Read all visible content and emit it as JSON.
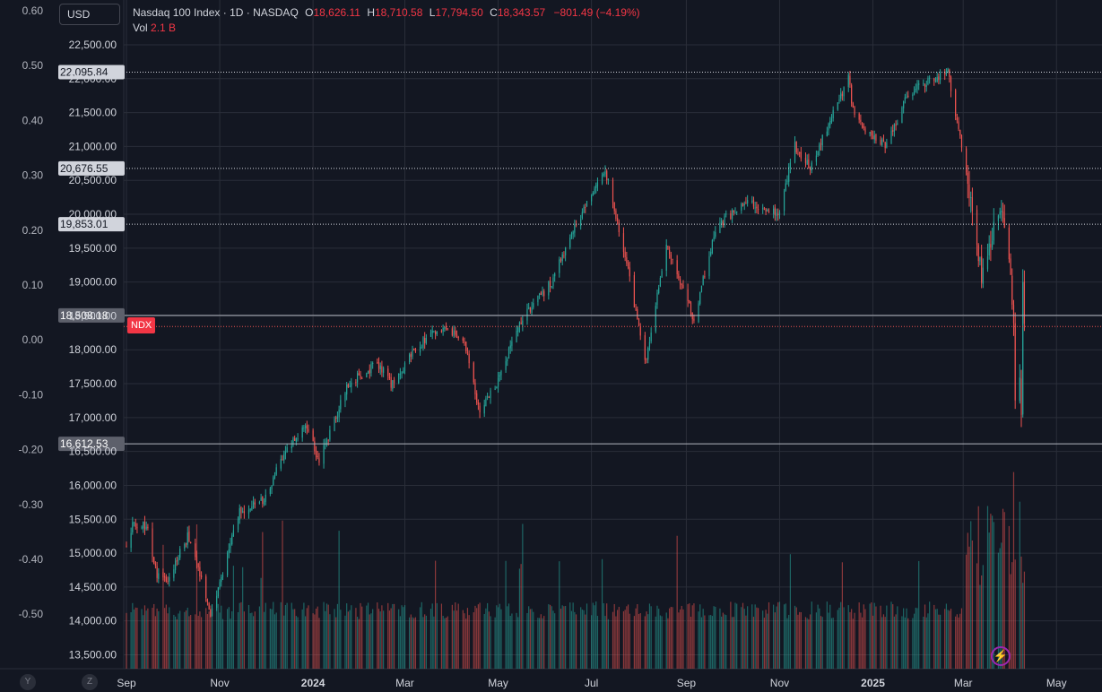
{
  "toolbar": {
    "currency": "USD"
  },
  "legend": {
    "symbol": "Nasdaq 100 Index",
    "interval": "1D",
    "exchange": "NASDAQ",
    "open_label": "O",
    "open": "18,626.11",
    "high_label": "H",
    "high": "18,710.58",
    "low_label": "L",
    "low": "17,794.50",
    "close_label": "C",
    "close": "18,343.57",
    "change": "−801.49 (−4.19%)",
    "vol_label": "Vol",
    "vol": "2.1 B"
  },
  "series_tag": "NDX",
  "corner_buttons": [
    "Y",
    "Z"
  ],
  "colors": {
    "background": "#131722",
    "grid": "#2a2e39",
    "up": "#26a69a",
    "down": "#ef5350",
    "accent": "#f23645"
  },
  "icons": {
    "alert": "lightning-icon"
  },
  "chart_data": {
    "type": "candlestick",
    "symbol": "NDX",
    "left_axis_ticks": [
      "0.60",
      "0.50",
      "0.40",
      "0.30",
      "0.20",
      "0.10",
      "0.00",
      "-0.10",
      "-0.20",
      "-0.30",
      "-0.40",
      "-0.50"
    ],
    "price_ticks": [
      "22,500.00",
      "22,000.00",
      "21,500.00",
      "21,000.00",
      "20,500.00",
      "20,000.00",
      "19,500.00",
      "19,000.00",
      "18,500.00",
      "18,000.00",
      "17,500.00",
      "17,000.00",
      "16,500.00",
      "16,000.00",
      "15,500.00",
      "15,000.00",
      "14,500.00",
      "14,000.00",
      "13,500.00"
    ],
    "price_markers": [
      {
        "value": 22095.84,
        "label": "22,095.84"
      },
      {
        "value": 20676.55,
        "label": "20,676.55"
      },
      {
        "value": 19853.01,
        "label": "19,853.01"
      },
      {
        "value": 18508.18,
        "label": "18,508.18"
      },
      {
        "value": 16612.53,
        "label": "16,612.53"
      }
    ],
    "time_labels": [
      {
        "label": "Sep",
        "date": "2023-09-01"
      },
      {
        "label": "Nov",
        "date": "2023-11-01"
      },
      {
        "label": "2024",
        "date": "2024-01-01",
        "bold": true
      },
      {
        "label": "Mar",
        "date": "2024-03-01"
      },
      {
        "label": "May",
        "date": "2024-05-01"
      },
      {
        "label": "Jul",
        "date": "2024-07-01"
      },
      {
        "label": "Sep",
        "date": "2024-09-01"
      },
      {
        "label": "Nov",
        "date": "2024-11-01"
      },
      {
        "label": "2025",
        "date": "2025-01-01",
        "bold": true
      },
      {
        "label": "Mar",
        "date": "2025-03-01"
      },
      {
        "label": "May",
        "date": "2025-05-01"
      }
    ],
    "start_date": "2023-09-01",
    "end_date": "2025-04-10",
    "keypoints": [
      [
        "2023-09-01",
        15100
      ],
      [
        "2023-09-05",
        15450
      ],
      [
        "2023-09-14",
        15400
      ],
      [
        "2023-09-21",
        14700
      ],
      [
        "2023-09-28",
        14600
      ],
      [
        "2023-10-11",
        15250
      ],
      [
        "2023-10-20",
        14650
      ],
      [
        "2023-10-26",
        14100
      ],
      [
        "2023-11-01",
        14550
      ],
      [
        "2023-11-14",
        15600
      ],
      [
        "2023-11-30",
        15800
      ],
      [
        "2023-12-14",
        16500
      ],
      [
        "2023-12-27",
        16900
      ],
      [
        "2024-01-05",
        16350
      ],
      [
        "2024-01-24",
        17500
      ],
      [
        "2024-02-12",
        17800
      ],
      [
        "2024-02-21",
        17500
      ],
      [
        "2024-03-08",
        18000
      ],
      [
        "2024-03-21",
        18300
      ],
      [
        "2024-04-08",
        18200
      ],
      [
        "2024-04-19",
        17050
      ],
      [
        "2024-04-30",
        17500
      ],
      [
        "2024-05-15",
        18400
      ],
      [
        "2024-06-05",
        19000
      ],
      [
        "2024-06-20",
        19800
      ],
      [
        "2024-07-10",
        20650
      ],
      [
        "2024-07-24",
        19300
      ],
      [
        "2024-08-05",
        17800
      ],
      [
        "2024-08-19",
        19600
      ],
      [
        "2024-09-06",
        18450
      ],
      [
        "2024-09-20",
        19800
      ],
      [
        "2024-10-10",
        20200
      ],
      [
        "2024-10-31",
        20000
      ],
      [
        "2024-11-11",
        21000
      ],
      [
        "2024-11-21",
        20700
      ],
      [
        "2024-12-16",
        22000
      ],
      [
        "2024-12-20",
        21400
      ],
      [
        "2025-01-10",
        21000
      ],
      [
        "2025-01-24",
        21800
      ],
      [
        "2025-02-19",
        22100
      ],
      [
        "2025-03-04",
        20500
      ],
      [
        "2025-03-13",
        19100
      ],
      [
        "2025-03-25",
        20100
      ],
      [
        "2025-03-31",
        19300
      ],
      [
        "2025-04-03",
        18500
      ],
      [
        "2025-04-04",
        17200
      ],
      [
        "2025-04-07",
        17500
      ],
      [
        "2025-04-08",
        17100
      ],
      [
        "2025-04-09",
        18900
      ],
      [
        "2025-04-10",
        18343.57
      ]
    ],
    "volume_scale": "axis-less overlay"
  }
}
